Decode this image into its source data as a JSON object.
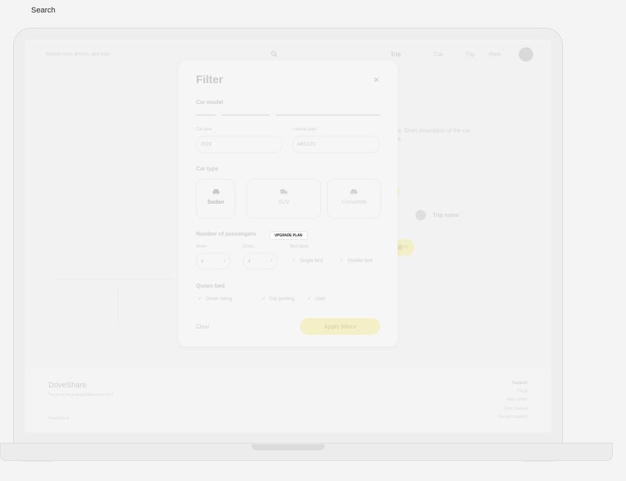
{
  "page": {
    "label": "Search"
  },
  "app": {
    "search": {
      "placeholder": "Search cars, drivers, and trips"
    },
    "nav": [
      {
        "label": "Trip",
        "active": true
      },
      {
        "label": "Car"
      },
      {
        "label": "Trip"
      },
      {
        "label": "Rent"
      }
    ],
    "background": {
      "description": "ne. Short description of the car.\nne.",
      "trip_name": "Trip name",
      "button_label": "re"
    },
    "footer": {
      "brand": "DriveShare",
      "tagline": "Your go-to car pooling platform since 1977",
      "copyright": "DriveShare ©",
      "links_heading": "Support",
      "links": [
        "FAQs",
        "Help center",
        "User manual",
        "Contact support"
      ]
    }
  },
  "filter": {
    "title": "Filter",
    "close_icon": "close-icon",
    "car_model": {
      "title": "Car model"
    },
    "car_year": {
      "label": "Car year",
      "value": "2020"
    },
    "license_plate": {
      "label": "License plate",
      "value": "ABC123"
    },
    "car_type": {
      "title": "Car type",
      "options": [
        {
          "label": "Sedan",
          "icon": "sedan-icon",
          "selected": true
        },
        {
          "label": "SUV",
          "icon": "suv-icon",
          "selected": false
        },
        {
          "label": "Convertibl",
          "icon": "convertible-icon",
          "selected": false
        }
      ]
    },
    "passengers": {
      "title": "Number of passengers",
      "badge": "UPGRADE PLAN",
      "seats": {
        "label": "Seats",
        "value": "4"
      },
      "doors": {
        "label": "Doors",
        "value": "4"
      },
      "bed_types": {
        "label": "Bed types",
        "options": [
          "Single bed",
          "Double bed"
        ]
      }
    },
    "queen_bed": {
      "title": "Queen bed",
      "options": [
        "Driver rating",
        "Car pooling",
        "User"
      ]
    },
    "clear_label": "Clear",
    "apply_label": "Apply filters"
  },
  "colors": {
    "accent": "#f3f0c8",
    "muted_text": "#cfcfcf"
  }
}
